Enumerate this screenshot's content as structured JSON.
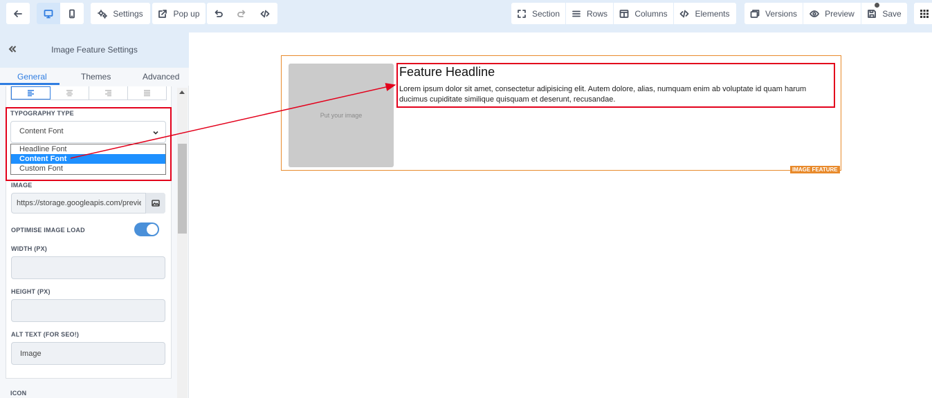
{
  "toolbar": {
    "back_icon": "arrow-left-icon",
    "device_desktop_icon": "monitor-icon",
    "device_mobile_icon": "phone-icon",
    "settings_label": "Settings",
    "popup_label": "Pop up",
    "undo_icon": "undo-icon",
    "redo_icon": "redo-icon",
    "code_icon": "code-icon",
    "section_label": "Section",
    "rows_label": "Rows",
    "columns_label": "Columns",
    "elements_label": "Elements",
    "versions_label": "Versions",
    "preview_label": "Preview",
    "save_label": "Save",
    "apps_icon": "grid-icon"
  },
  "panel": {
    "title": "Image Feature Settings",
    "tabs": [
      "General",
      "Themes",
      "Advanced"
    ],
    "active_tab": "General",
    "typography_label": "TYPOGRAPHY TYPE",
    "typography_value": "Content Font",
    "typography_options": [
      "Headline Font",
      "Content Font",
      "Custom Font"
    ],
    "image_label": "IMAGE",
    "image_url": "https://storage.googleapis.com/preview",
    "optimise_label": "OPTIMISE IMAGE LOAD",
    "optimise_on": true,
    "width_label": "WIDTH (PX)",
    "width_value": "",
    "height_label": "HEIGHT (PX)",
    "height_value": "",
    "alt_label": "ALT TEXT (FOR SEO!)",
    "alt_value": "Image",
    "icon_label": "ICON"
  },
  "canvas": {
    "image_placeholder": "Put your image",
    "headline": "Feature Headline",
    "body": "Lorem ipsum dolor sit amet, consectetur adipisicing elit. Autem dolore, alias, numquam enim ab voluptate id quam harum ducimus cupiditate similique quisquam et deserunt, recusandae.",
    "tag": "IMAGE FEATURE"
  },
  "colors": {
    "accent": "#2f7de1",
    "toolbar_bg": "#e2edf9",
    "feature_border": "#e88a2b",
    "annotation": "#e3001b",
    "dropdown_selected": "#1e90ff"
  }
}
